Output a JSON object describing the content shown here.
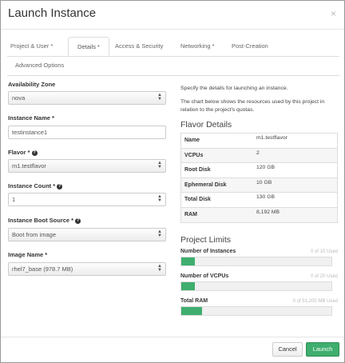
{
  "dialog": {
    "title": "Launch Instance",
    "close_glyph": "×"
  },
  "tabs": [
    {
      "label": "Project & User *",
      "active": false
    },
    {
      "label": "Details *",
      "active": true
    },
    {
      "label": "Access & Security",
      "active": false
    },
    {
      "label": "Networking *",
      "active": false
    },
    {
      "label": "Post-Creation",
      "active": false
    },
    {
      "label": "Advanced Options",
      "active": false
    }
  ],
  "form": {
    "availability_zone": {
      "label": "Availability Zone",
      "value": "nova"
    },
    "instance_name": {
      "label": "Instance Name *",
      "value": "testinstance1"
    },
    "flavor": {
      "label": "Flavor *",
      "value": "m1.testflavor"
    },
    "instance_count": {
      "label": "Instance Count *",
      "value": "1"
    },
    "boot_source": {
      "label": "Instance Boot Source *",
      "value": "Boot from image"
    },
    "image_name": {
      "label": "Image Name *",
      "value": "rhel7_base (978.7 MB)"
    }
  },
  "info": {
    "specify_text": "Specify the details for launching an instance.",
    "chart_text": "The chart below shows the resources used by this project in relation to the project's quotas."
  },
  "flavor_details": {
    "title": "Flavor Details",
    "rows": [
      {
        "key": "Name",
        "value": "m1.testflavor"
      },
      {
        "key": "VCPUs",
        "value": "2"
      },
      {
        "key": "Root Disk",
        "value": "120 GB"
      },
      {
        "key": "Ephemeral Disk",
        "value": "10 GB"
      },
      {
        "key": "Total Disk",
        "value": "130 GB"
      },
      {
        "key": "RAM",
        "value": "8,192 MB"
      }
    ]
  },
  "project_limits": {
    "title": "Project Limits",
    "items": [
      {
        "label": "Number of Instances",
        "used_text": "0 of 10 Used",
        "fill": 0.09
      },
      {
        "label": "Number of VCPUs",
        "used_text": "0 of 20 Used",
        "fill": 0.09
      },
      {
        "label": "Total RAM",
        "used_text": "0 of 51,200 MB Used",
        "fill": 0.14
      }
    ],
    "bar_color": "#3fae6e"
  },
  "footer": {
    "cancel_label": "Cancel",
    "launch_label": "Launch"
  },
  "colors": {
    "primary": "#3fae6e"
  }
}
